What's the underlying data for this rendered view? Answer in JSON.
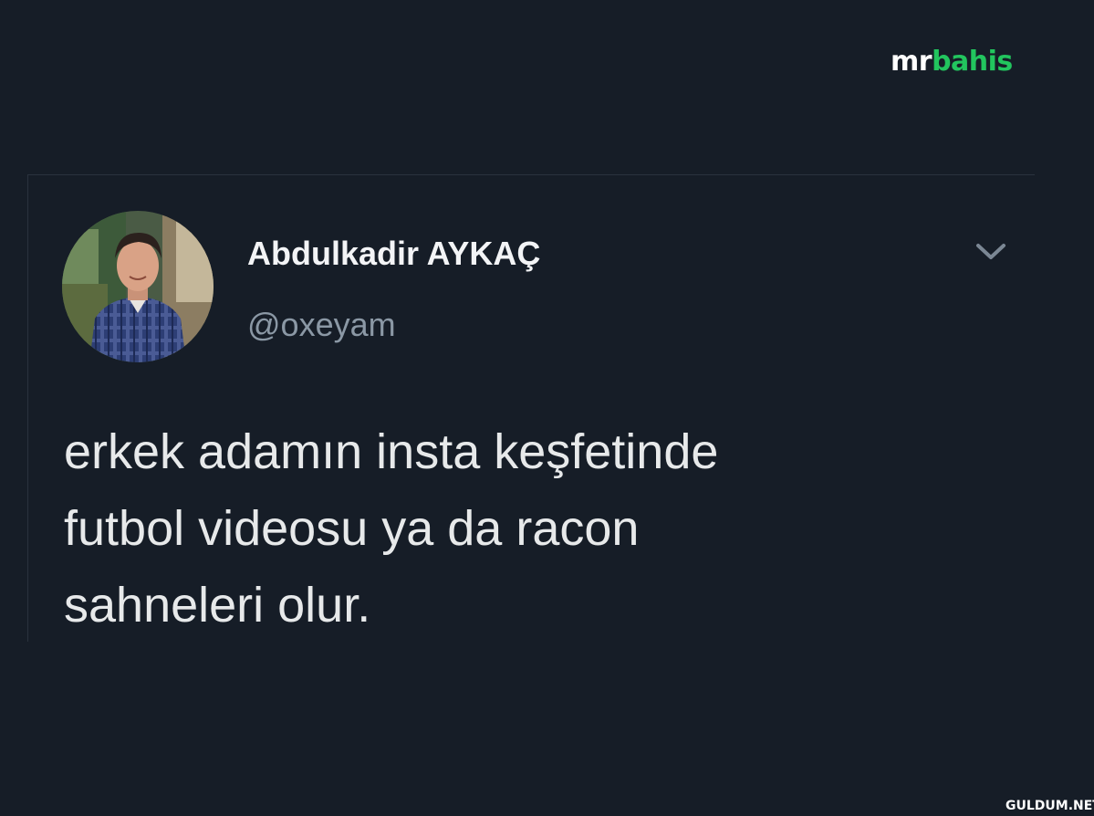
{
  "logo": {
    "part1": "mr",
    "part2": "bahis",
    "colors": {
      "mr": "#ffffff",
      "bahis": "#22c55e"
    }
  },
  "tweet": {
    "display_name": "Abdulkadir AYKAÇ",
    "handle": "@oxeyam",
    "text_lines": [
      "erkek adamın insta keşfetinde",
      "futbol videosu ya da racon",
      "sahneleri olur."
    ],
    "menu_icon": "chevron-down-icon"
  },
  "watermark": "GULDUM.NET",
  "colors": {
    "background": "#161d27",
    "name": "#f3f4f6",
    "handle": "#8b98a5",
    "text": "#e7e9ea"
  }
}
